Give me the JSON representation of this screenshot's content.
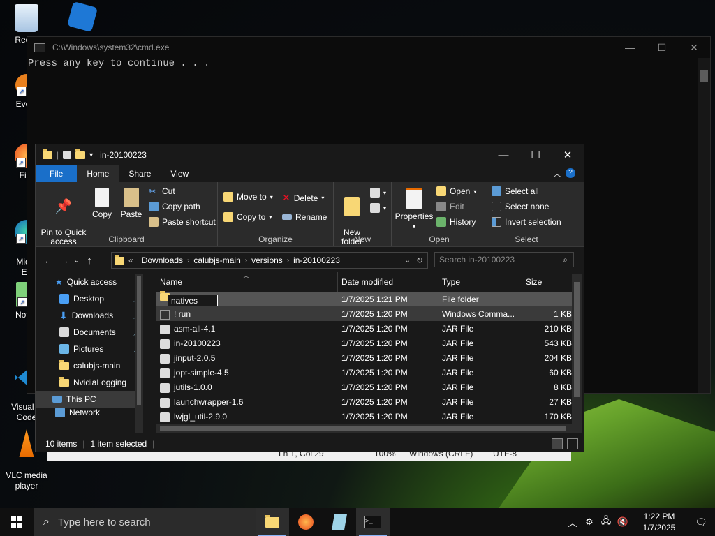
{
  "desktop": {
    "icons": [
      {
        "label": "Recyc",
        "icon": "recycle-bin-icon"
      },
      {
        "label": "",
        "icon": "roblox-icon"
      },
      {
        "label": "Every",
        "icon": "everything-icon"
      },
      {
        "label": "Fire",
        "icon": "firefox-icon"
      },
      {
        "label": "Micro\nEd",
        "icon": "edge-icon"
      },
      {
        "label": "Notep",
        "icon": "notepad-icon"
      },
      {
        "label": "Visual S\nCode",
        "icon": "vscode-icon"
      },
      {
        "label": "VLC media\nplayer",
        "icon": "vlc-icon"
      }
    ]
  },
  "cmd": {
    "title": "C:\\Windows\\system32\\cmd.exe",
    "output": "Press any key to continue . . .",
    "controls": {
      "minimize": "—",
      "maximize": "☐",
      "close": "✕"
    }
  },
  "notepad_status": {
    "position": "Ln 1, Col 29",
    "zoom": "100%",
    "line_ending": "Windows (CRLF)",
    "encoding": "UTF-8"
  },
  "explorer": {
    "title": "in-20100223",
    "controls": {
      "minimize": "—",
      "maximize": "☐",
      "close": "✕"
    },
    "tabs": [
      "File",
      "Home",
      "Share",
      "View"
    ],
    "ribbon": {
      "clipboard": {
        "pin": "Pin to Quick\naccess",
        "copy": "Copy",
        "paste": "Paste",
        "cut": "Cut",
        "copy_path": "Copy path",
        "paste_shortcut": "Paste shortcut",
        "group": "Clipboard"
      },
      "organize": {
        "move_to": "Move to",
        "copy_to": "Copy to",
        "delete": "Delete",
        "rename": "Rename",
        "group": "Organize"
      },
      "new": {
        "new_folder": "New\nfolder",
        "group": "New"
      },
      "open": {
        "properties": "Properties",
        "open": "Open",
        "edit": "Edit",
        "history": "History",
        "group": "Open"
      },
      "select": {
        "select_all": "Select all",
        "select_none": "Select none",
        "invert": "Invert selection",
        "group": "Select"
      }
    },
    "address": {
      "overflow": "«",
      "crumbs": [
        "Downloads",
        "calubjs-main",
        "versions",
        "in-20100223"
      ]
    },
    "search_placeholder": "Search in-20100223",
    "sidebar": [
      {
        "label": "Quick access",
        "icon": "star-icon",
        "pinned": false
      },
      {
        "label": "Desktop",
        "icon": "desktop-icon",
        "pinned": true
      },
      {
        "label": "Downloads",
        "icon": "download-icon",
        "pinned": true
      },
      {
        "label": "Documents",
        "icon": "documents-icon",
        "pinned": true
      },
      {
        "label": "Pictures",
        "icon": "pictures-icon",
        "pinned": true
      },
      {
        "label": "calubjs-main",
        "icon": "folder-icon",
        "pinned": false
      },
      {
        "label": "NvidiaLogging",
        "icon": "folder-icon",
        "pinned": false
      },
      {
        "label": "This PC",
        "icon": "pc-icon",
        "pinned": false
      },
      {
        "label": "Network",
        "icon": "network-icon",
        "pinned": false
      }
    ],
    "columns": [
      "Name",
      "Date modified",
      "Type",
      "Size"
    ],
    "files": [
      {
        "name": "natives",
        "date": "1/7/2025 1:21 PM",
        "type": "File folder",
        "size": "",
        "kind": "folder"
      },
      {
        "name": "! run",
        "date": "1/7/2025 1:20 PM",
        "type": "Windows Comma...",
        "size": "1 KB",
        "kind": "cmd"
      },
      {
        "name": "asm-all-4.1",
        "date": "1/7/2025 1:20 PM",
        "type": "JAR File",
        "size": "210 KB",
        "kind": "jar"
      },
      {
        "name": "in-20100223",
        "date": "1/7/2025 1:20 PM",
        "type": "JAR File",
        "size": "543 KB",
        "kind": "jar"
      },
      {
        "name": "jinput-2.0.5",
        "date": "1/7/2025 1:20 PM",
        "type": "JAR File",
        "size": "204 KB",
        "kind": "jar"
      },
      {
        "name": "jopt-simple-4.5",
        "date": "1/7/2025 1:20 PM",
        "type": "JAR File",
        "size": "60 KB",
        "kind": "jar"
      },
      {
        "name": "jutils-1.0.0",
        "date": "1/7/2025 1:20 PM",
        "type": "JAR File",
        "size": "8 KB",
        "kind": "jar"
      },
      {
        "name": "launchwrapper-1.6",
        "date": "1/7/2025 1:20 PM",
        "type": "JAR File",
        "size": "27 KB",
        "kind": "jar"
      },
      {
        "name": "lwjgl_util-2.9.0",
        "date": "1/7/2025 1:20 PM",
        "type": "JAR File",
        "size": "170 KB",
        "kind": "jar"
      }
    ],
    "status": {
      "count": "10 items",
      "selected": "1 item selected"
    }
  },
  "taskbar": {
    "search_placeholder": "Type here to search",
    "apps": [
      "file-explorer-icon",
      "firefox-icon",
      "notepad-icon",
      "terminal-icon"
    ],
    "time": "1:22 PM",
    "date": "1/7/2025"
  },
  "colors": {
    "accent": "#1a6fc9",
    "dark": "#191919",
    "ribbon": "#2b2b2b"
  }
}
